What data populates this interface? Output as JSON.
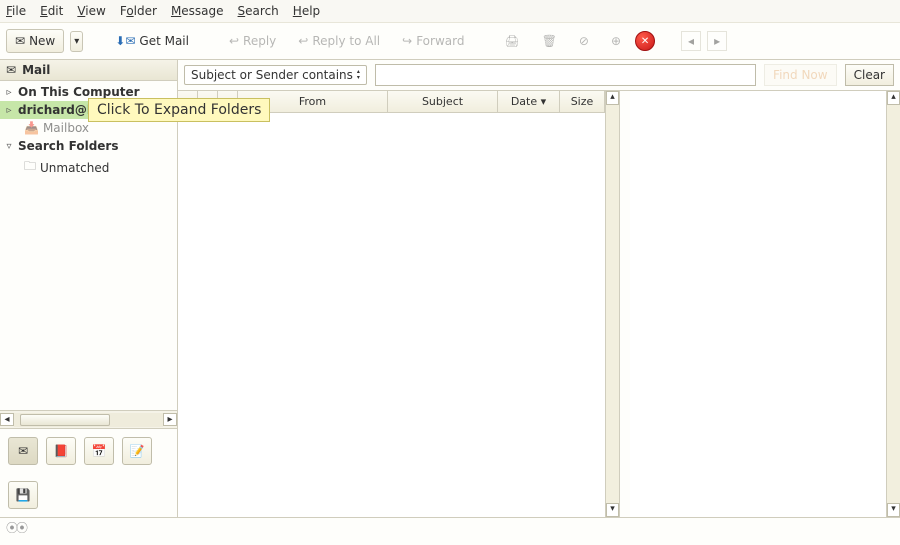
{
  "menu": {
    "file": "File",
    "edit": "Edit",
    "view": "View",
    "folder": "Folder",
    "message": "Message",
    "search": "Search",
    "help": "Help"
  },
  "toolbar": {
    "new": "New",
    "getmail": "Get Mail",
    "reply": "Reply",
    "replyall": "Reply to All",
    "forward": "Forward"
  },
  "sidebar": {
    "header": "Mail",
    "row_on_computer": "On This Computer",
    "row_account": "drichard@larg",
    "row_mailbox": "Mailbox",
    "row_searchfolders": "Search Folders",
    "row_unmatched": "Unmatched"
  },
  "callout": "Click To Expand Folders",
  "search": {
    "combo": "Subject or Sender contains",
    "placeholder": "",
    "findnow": "Find Now",
    "clear": "Clear"
  },
  "columns": {
    "from": "From",
    "subject": "Subject",
    "date": "Date",
    "size": "Size"
  },
  "switcher": {
    "mail": "mail-icon",
    "contacts": "book-icon",
    "calendar": "calendar-icon",
    "memos": "note-icon",
    "misc": "disk-icon"
  }
}
